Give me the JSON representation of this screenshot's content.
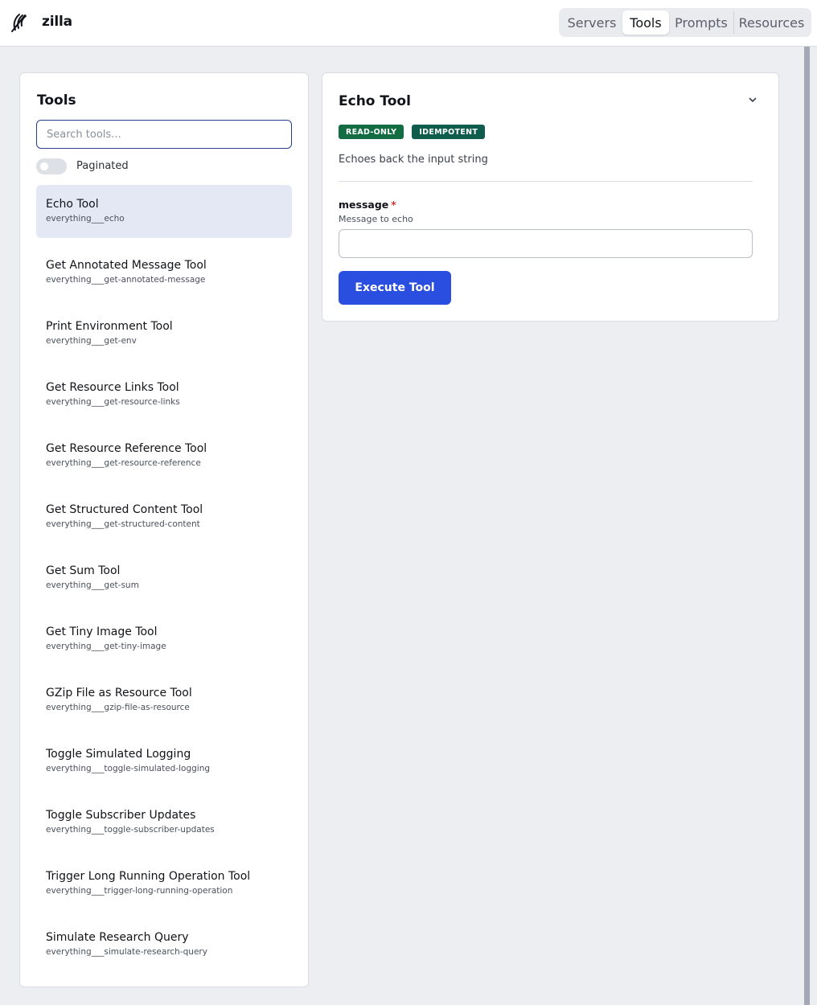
{
  "app": {
    "name": "zilla",
    "logo_icon": "feather-logo-icon"
  },
  "nav": {
    "tabs": [
      {
        "label": "Servers",
        "active": false
      },
      {
        "label": "Tools",
        "active": true
      },
      {
        "label": "Prompts",
        "active": false
      },
      {
        "label": "Resources",
        "active": false
      }
    ]
  },
  "tools_panel": {
    "title": "Tools",
    "search": {
      "placeholder": "Search tools...",
      "value": ""
    },
    "paginated": {
      "label": "Paginated",
      "enabled": false
    },
    "items": [
      {
        "name": "Echo Tool",
        "id": "everything___echo",
        "selected": true
      },
      {
        "name": "Get Annotated Message Tool",
        "id": "everything___get-annotated-message",
        "selected": false
      },
      {
        "name": "Print Environment Tool",
        "id": "everything___get-env",
        "selected": false
      },
      {
        "name": "Get Resource Links Tool",
        "id": "everything___get-resource-links",
        "selected": false
      },
      {
        "name": "Get Resource Reference Tool",
        "id": "everything___get-resource-reference",
        "selected": false
      },
      {
        "name": "Get Structured Content Tool",
        "id": "everything___get-structured-content",
        "selected": false
      },
      {
        "name": "Get Sum Tool",
        "id": "everything___get-sum",
        "selected": false
      },
      {
        "name": "Get Tiny Image Tool",
        "id": "everything___get-tiny-image",
        "selected": false
      },
      {
        "name": "GZip File as Resource Tool",
        "id": "everything___gzip-file-as-resource",
        "selected": false
      },
      {
        "name": "Toggle Simulated Logging",
        "id": "everything___toggle-simulated-logging",
        "selected": false
      },
      {
        "name": "Toggle Subscriber Updates",
        "id": "everything___toggle-subscriber-updates",
        "selected": false
      },
      {
        "name": "Trigger Long Running Operation Tool",
        "id": "everything___trigger-long-running-operation",
        "selected": false
      },
      {
        "name": "Simulate Research Query",
        "id": "everything___simulate-research-query",
        "selected": false
      }
    ]
  },
  "detail": {
    "title": "Echo Tool",
    "collapse_icon": "chevron-down-icon",
    "badges": [
      {
        "label": "READ-ONLY",
        "color": "#146c43"
      },
      {
        "label": "IDEMPOTENT",
        "color": "#0f5c4c"
      }
    ],
    "description": "Echoes back the input string",
    "field": {
      "label": "message",
      "required_mark": "*",
      "help": "Message to echo",
      "value": "",
      "placeholder": ""
    },
    "execute_label": "Execute Tool"
  },
  "colors": {
    "accent": "#2a4ee0",
    "selected_bg": "#e4e8f5",
    "page_bg": "#eceef2",
    "required": "#d32f2f"
  }
}
